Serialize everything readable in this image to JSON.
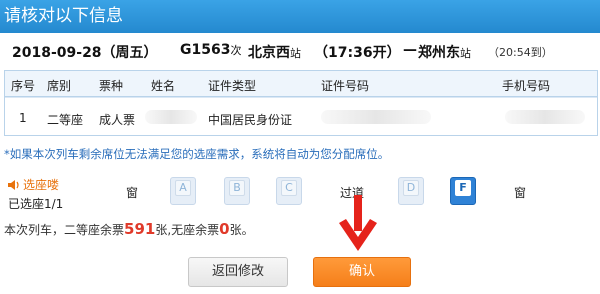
{
  "dialog": {
    "title": "请核对以下信息"
  },
  "trip": {
    "date": "2018-09-28（周五）",
    "train_no": "G1563",
    "train_suffix": "次",
    "from_station": "北京西",
    "from_suffix": "站",
    "depart_time": "（17:36开）",
    "separator": "—",
    "to_station": "郑州东",
    "to_suffix": "站",
    "arrive_time": "（20:54到）"
  },
  "table": {
    "headers": [
      "序号",
      "席别",
      "票种",
      "姓名",
      "证件类型",
      "证件号码",
      "手机号码"
    ],
    "rows": [
      {
        "index": "1",
        "seat_class": "二等座",
        "ticket_type": "成人票",
        "id_type": "中国居民身份证"
      }
    ]
  },
  "notice": "*如果本次列车剩余席位无法满足您的选座需求，系统将自动为您分配席位。",
  "seat_picker": {
    "title": "选座喽",
    "selected": "已选座1/1",
    "window_label": "窗",
    "aisle_label": "过道",
    "seats": [
      "A",
      "B",
      "C",
      "D",
      "F"
    ],
    "selected_seat": "F"
  },
  "remaining": {
    "prefix": "本次列车，二等座余票",
    "seat_count": "591",
    "mid": "张,无座余票",
    "standing_count": "0",
    "suffix": "张。"
  },
  "buttons": {
    "back": "返回修改",
    "confirm": "确认"
  },
  "colors": {
    "accent": "#2489cf",
    "confirm": "#f57f1a",
    "highlight": "#e03a2a",
    "seat_selected": "#2f82d6"
  },
  "icons": {
    "speaker": "speaker-icon",
    "arrow": "arrow-down-icon"
  }
}
